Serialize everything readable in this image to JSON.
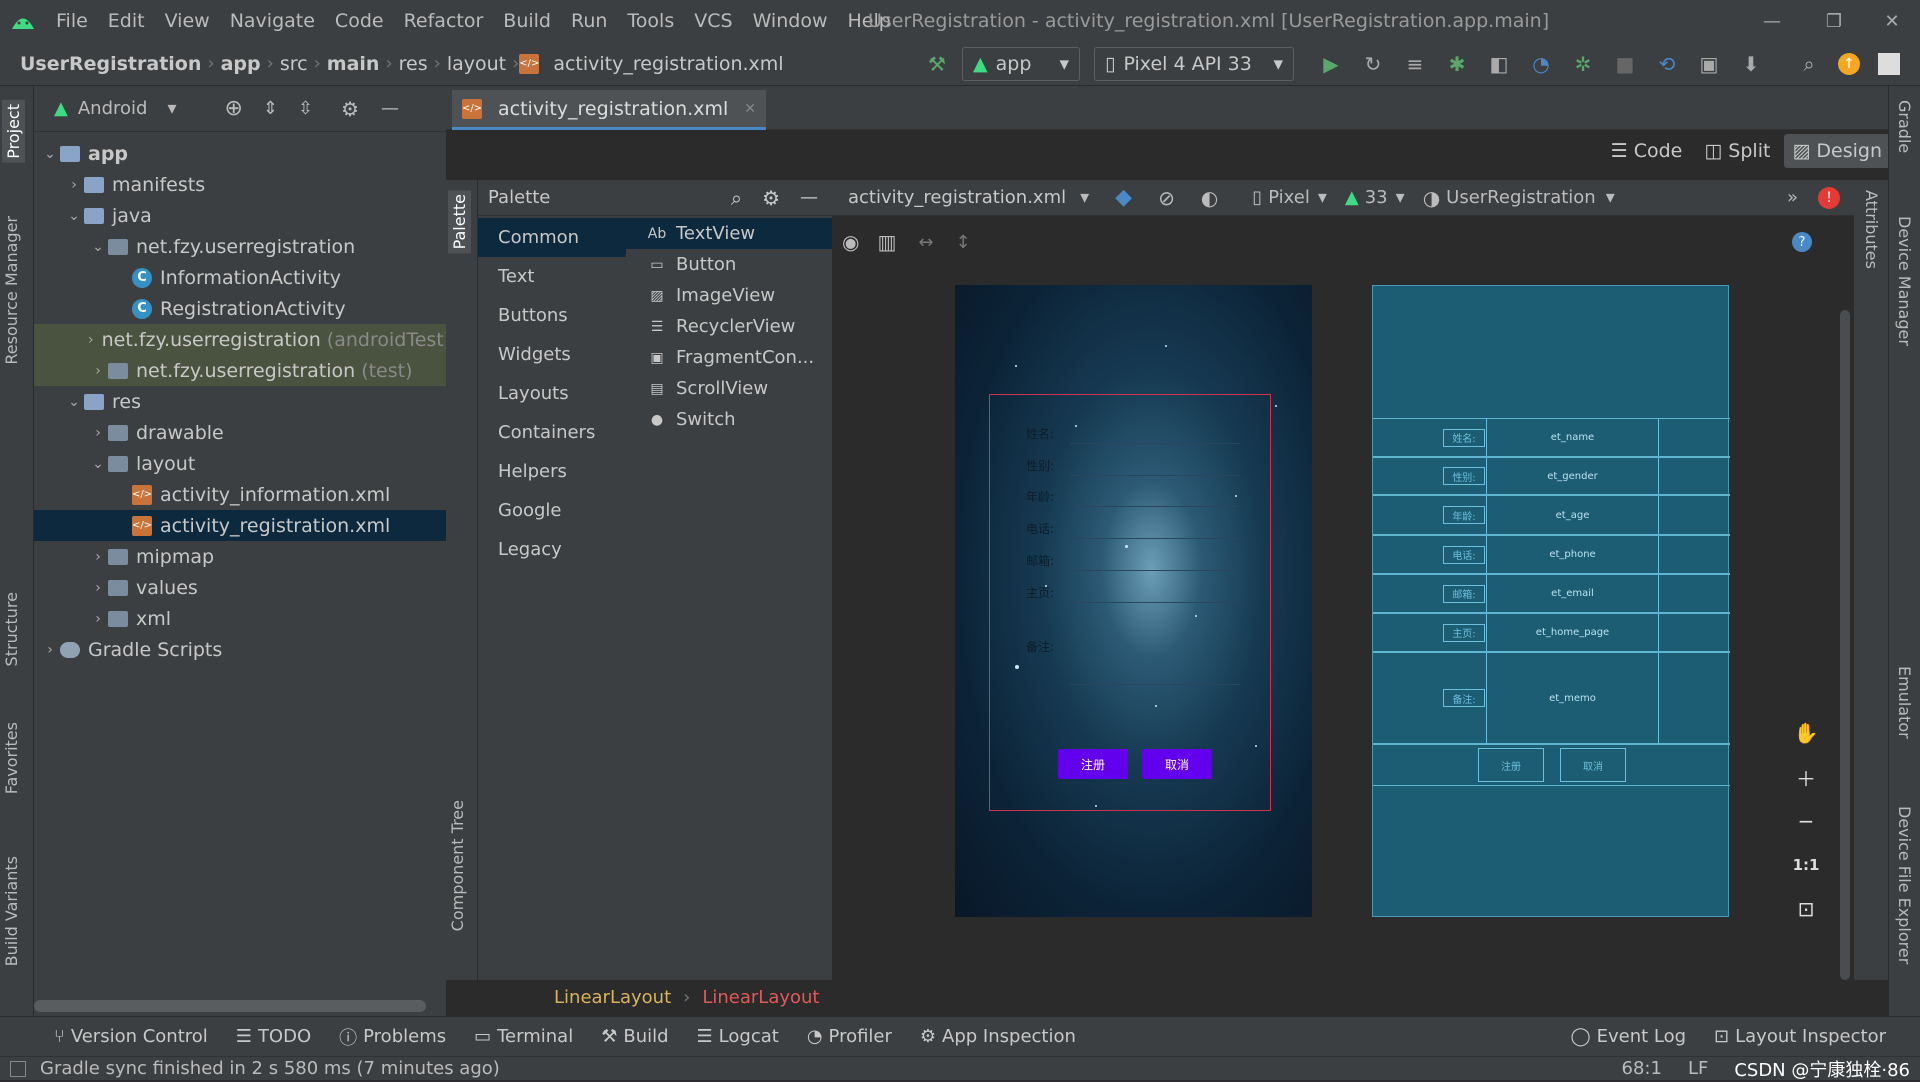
{
  "menu": [
    "File",
    "Edit",
    "View",
    "Navigate",
    "Code",
    "Refactor",
    "Build",
    "Run",
    "Tools",
    "VCS",
    "Window",
    "Help"
  ],
  "window_title": "UserRegistration - activity_registration.xml [UserRegistration.app.main]",
  "breadcrumb": [
    "UserRegistration",
    "app",
    "src",
    "main",
    "res",
    "layout",
    "activity_registration.xml"
  ],
  "run_config": "app",
  "device": "Pixel 4 API 33",
  "left_tabs": [
    "Project",
    "Resource Manager",
    "Structure",
    "Favorites",
    "Build Variants"
  ],
  "project": {
    "view": "Android",
    "tree": [
      {
        "label": "app",
        "indent": 0,
        "arrow": "v",
        "icon": "folder",
        "bold": true
      },
      {
        "label": "manifests",
        "indent": 1,
        "arrow": ">",
        "icon": "folder"
      },
      {
        "label": "java",
        "indent": 1,
        "arrow": "v",
        "icon": "folder"
      },
      {
        "label": "net.fzy.userregistration",
        "indent": 2,
        "arrow": "v",
        "icon": "pkg"
      },
      {
        "label": "InformationActivity",
        "indent": 3,
        "arrow": "",
        "icon": "class"
      },
      {
        "label": "RegistrationActivity",
        "indent": 3,
        "arrow": "",
        "icon": "class"
      },
      {
        "label": "net.fzy.userregistration",
        "suffix": "(androidTest)",
        "indent": 2,
        "arrow": ">",
        "icon": "pkg",
        "hl": true
      },
      {
        "label": "net.fzy.userregistration",
        "suffix": "(test)",
        "indent": 2,
        "arrow": ">",
        "icon": "pkg",
        "hl": true
      },
      {
        "label": "res",
        "indent": 1,
        "arrow": "v",
        "icon": "folder"
      },
      {
        "label": "drawable",
        "indent": 2,
        "arrow": ">",
        "icon": "pkg"
      },
      {
        "label": "layout",
        "indent": 2,
        "arrow": "v",
        "icon": "pkg"
      },
      {
        "label": "activity_information.xml",
        "indent": 3,
        "arrow": "",
        "icon": "xml"
      },
      {
        "label": "activity_registration.xml",
        "indent": 3,
        "arrow": "",
        "icon": "xml",
        "selected": true
      },
      {
        "label": "mipmap",
        "indent": 2,
        "arrow": ">",
        "icon": "pkg"
      },
      {
        "label": "values",
        "indent": 2,
        "arrow": ">",
        "icon": "pkg"
      },
      {
        "label": "xml",
        "indent": 2,
        "arrow": ">",
        "icon": "pkg"
      },
      {
        "label": "Gradle Scripts",
        "indent": 0,
        "arrow": ">",
        "icon": "gradle"
      }
    ]
  },
  "editor_tab": "activity_registration.xml",
  "view_modes": [
    "Code",
    "Split",
    "Design"
  ],
  "palette": {
    "title": "Palette",
    "strip_labels": [
      "Palette",
      "Component Tree"
    ],
    "categories": [
      "Common",
      "Text",
      "Buttons",
      "Widgets",
      "Layouts",
      "Containers",
      "Helpers",
      "Google",
      "Legacy"
    ],
    "items": [
      {
        "icon": "Ab",
        "label": "TextView"
      },
      {
        "icon": "btn",
        "label": "Button"
      },
      {
        "icon": "img",
        "label": "ImageView"
      },
      {
        "icon": "list",
        "label": "RecyclerView"
      },
      {
        "icon": "frag",
        "label": "FragmentCon..."
      },
      {
        "icon": "scroll",
        "label": "ScrollView"
      },
      {
        "icon": "switch",
        "label": "Switch"
      }
    ]
  },
  "design_toolbar": {
    "file": "activity_registration.xml",
    "device": "Pixel",
    "api": "33",
    "theme": "UserRegistration"
  },
  "form": {
    "labels": [
      "姓名:",
      "性别:",
      "年龄:",
      "电话:",
      "邮箱:",
      "主页:",
      "备注:"
    ],
    "buttons": [
      "注册",
      "取消"
    ]
  },
  "blueprint": {
    "labels": [
      "姓名:",
      "性别:",
      "年龄:",
      "电话:",
      "邮箱:",
      "主页:",
      "备注:"
    ],
    "fields": [
      "et_name",
      "et_gender",
      "et_age",
      "et_phone",
      "et_email",
      "et_home_page",
      "et_memo"
    ],
    "buttons": [
      "注册",
      "取消"
    ]
  },
  "zoom": {
    "reset": "1:1"
  },
  "right_tabs": [
    "Gradle",
    "Device Manager",
    "Emulator",
    "Device File Explorer"
  ],
  "attr_tab": "Attributes",
  "layout_breadcrumb": [
    "LinearLayout",
    "LinearLayout"
  ],
  "bottom_tools": [
    "Version Control",
    "TODO",
    "Problems",
    "Terminal",
    "Build",
    "Logcat",
    "Profiler",
    "App Inspection"
  ],
  "bottom_right_tools": [
    "Event Log",
    "Layout Inspector"
  ],
  "status": {
    "message": "Gradle sync finished in 2 s 580 ms (7 minutes ago)",
    "position": "68:1",
    "line_sep": "LF",
    "watermark": "CSDN @宁康独栓·86"
  },
  "colors": {
    "accent": "#4a88c7",
    "selection": "#0d293e",
    "button": "#6200ee",
    "blueprint": "#1d5d74",
    "error": "#e53935"
  }
}
